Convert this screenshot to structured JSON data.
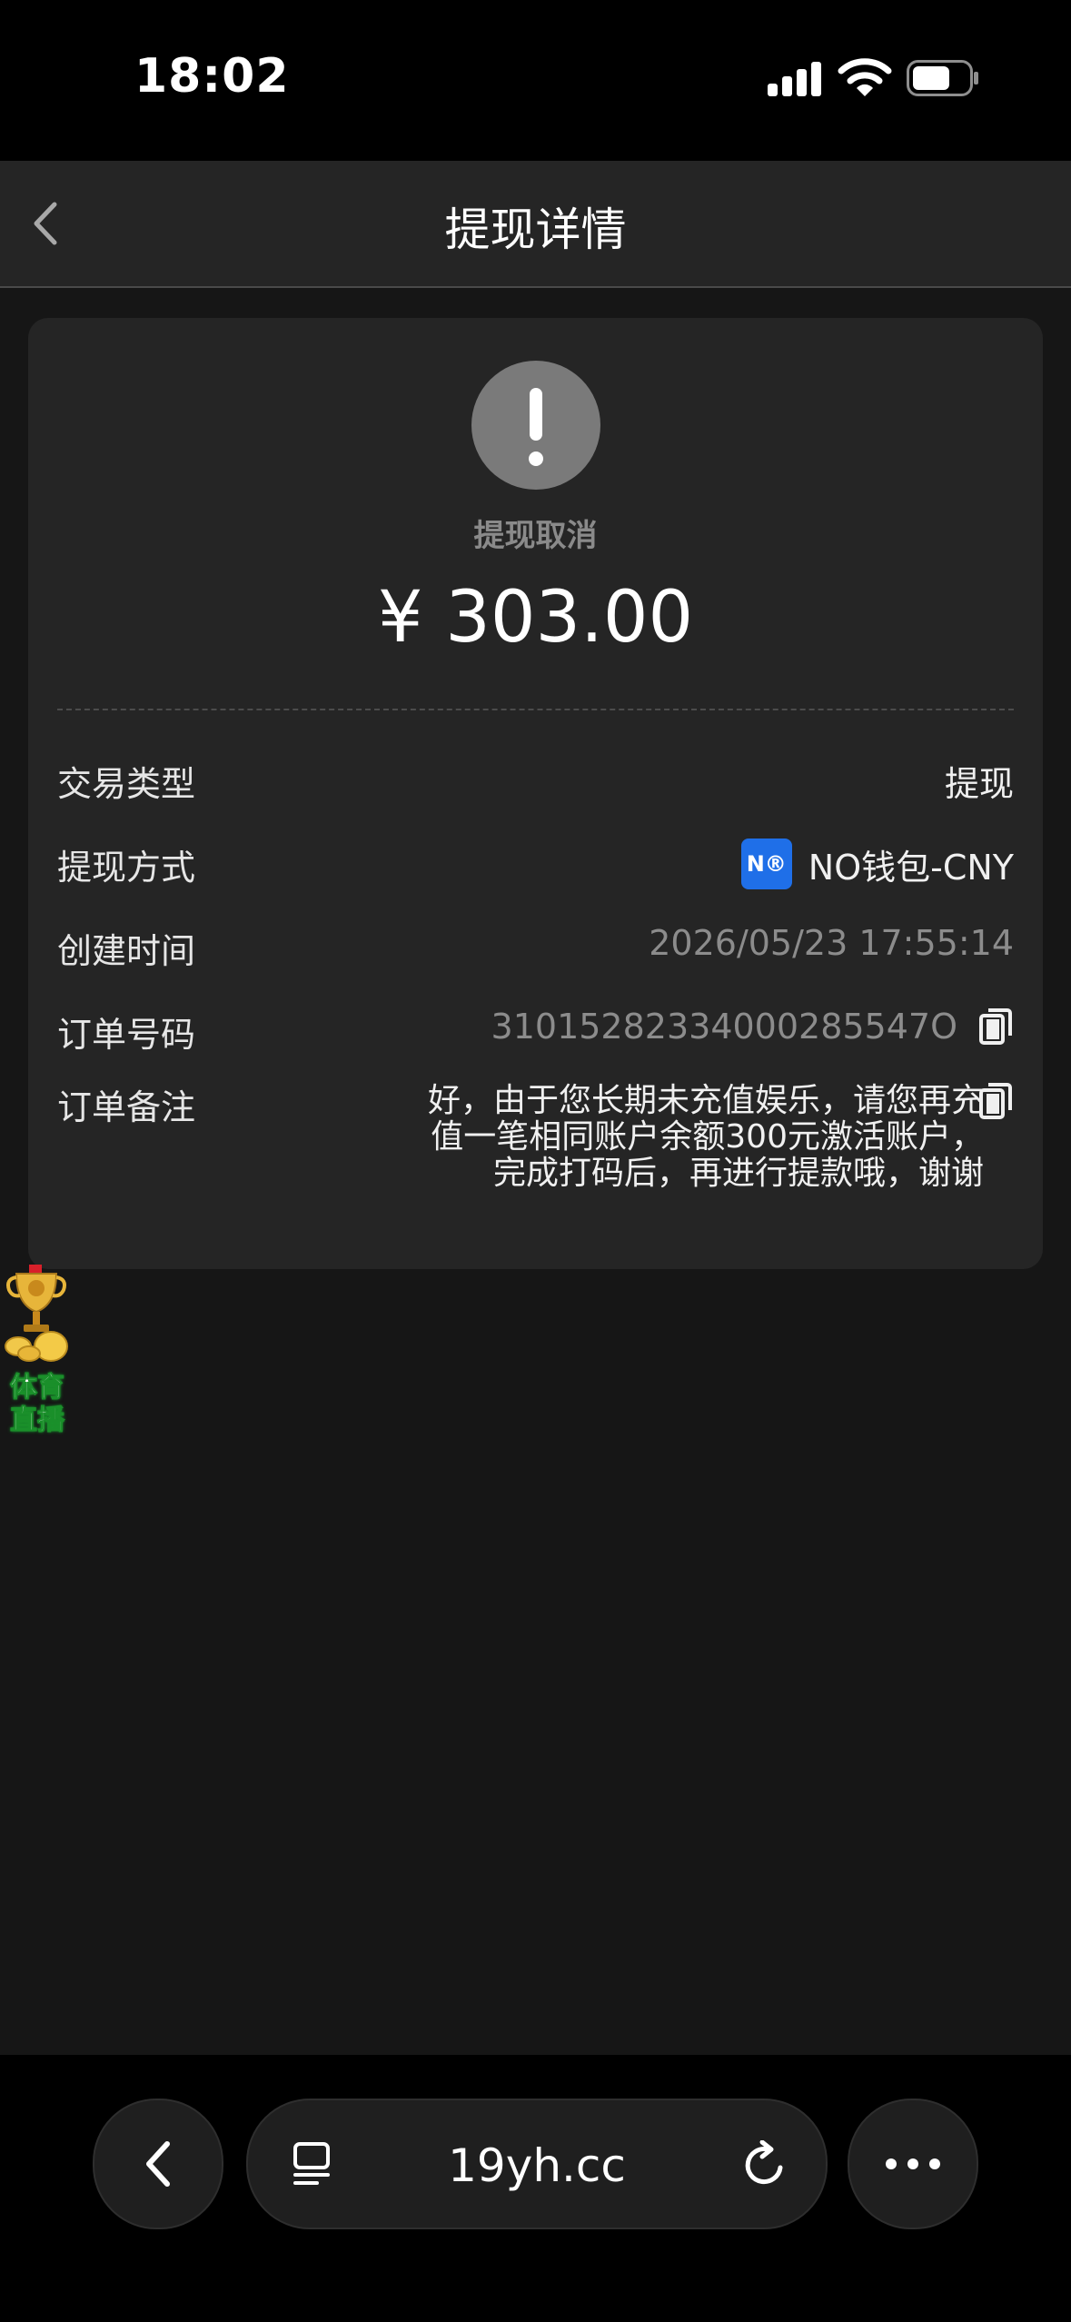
{
  "status_bar": {
    "time": "18:02"
  },
  "header": {
    "title": "提现详情"
  },
  "summary": {
    "status": "提现取消",
    "amount": "¥ 303.00"
  },
  "details": {
    "type_label": "交易类型",
    "type_value": "提现",
    "method_label": "提现方式",
    "method_logo": "N®",
    "method_value": "NO钱包-CNY",
    "time_label": "创建时间",
    "time_value": "2026/05/23 17:55:14",
    "order_label": "订单号码",
    "order_value": "31015282334000285547O",
    "remark_label": "订单备注",
    "remark_value": "好，由于您长期未充值娱乐，请您再充值一笔相同账户余额300元激活账户，完成打码后，再进行提款哦，谢谢"
  },
  "floating_badge": {
    "line1": "体育",
    "line2": "直播"
  },
  "browser": {
    "url": "19yh.cc"
  },
  "colors": {
    "background": "#161616",
    "card": "#252525",
    "wallet_brand": "#1f6fe8",
    "alert_icon": "#7a7a7a"
  }
}
